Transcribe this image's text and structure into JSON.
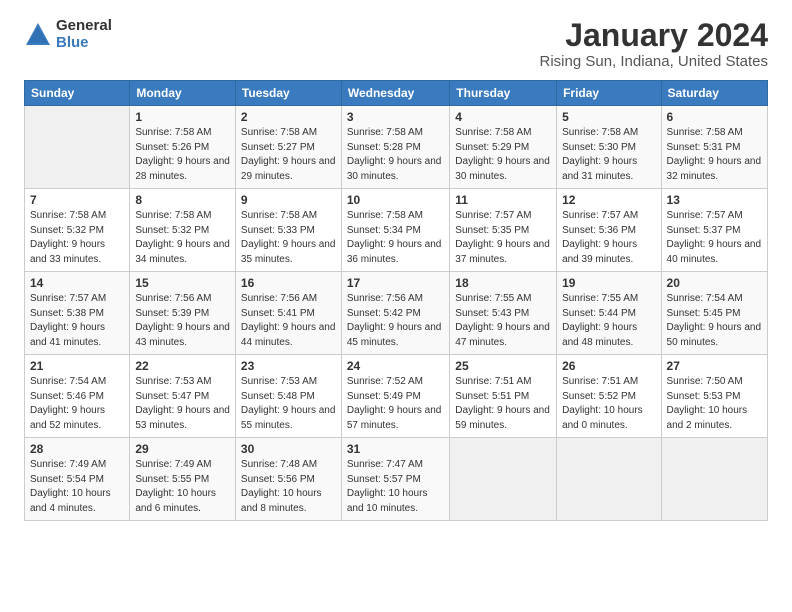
{
  "logo": {
    "general": "General",
    "blue": "Blue"
  },
  "title": "January 2024",
  "subtitle": "Rising Sun, Indiana, United States",
  "weekdays": [
    "Sunday",
    "Monday",
    "Tuesday",
    "Wednesday",
    "Thursday",
    "Friday",
    "Saturday"
  ],
  "weeks": [
    [
      {
        "day": "",
        "sunrise": "",
        "sunset": "",
        "daylight": ""
      },
      {
        "day": "1",
        "sunrise": "Sunrise: 7:58 AM",
        "sunset": "Sunset: 5:26 PM",
        "daylight": "Daylight: 9 hours and 28 minutes."
      },
      {
        "day": "2",
        "sunrise": "Sunrise: 7:58 AM",
        "sunset": "Sunset: 5:27 PM",
        "daylight": "Daylight: 9 hours and 29 minutes."
      },
      {
        "day": "3",
        "sunrise": "Sunrise: 7:58 AM",
        "sunset": "Sunset: 5:28 PM",
        "daylight": "Daylight: 9 hours and 30 minutes."
      },
      {
        "day": "4",
        "sunrise": "Sunrise: 7:58 AM",
        "sunset": "Sunset: 5:29 PM",
        "daylight": "Daylight: 9 hours and 30 minutes."
      },
      {
        "day": "5",
        "sunrise": "Sunrise: 7:58 AM",
        "sunset": "Sunset: 5:30 PM",
        "daylight": "Daylight: 9 hours and 31 minutes."
      },
      {
        "day": "6",
        "sunrise": "Sunrise: 7:58 AM",
        "sunset": "Sunset: 5:31 PM",
        "daylight": "Daylight: 9 hours and 32 minutes."
      }
    ],
    [
      {
        "day": "7",
        "sunrise": "Sunrise: 7:58 AM",
        "sunset": "Sunset: 5:32 PM",
        "daylight": "Daylight: 9 hours and 33 minutes."
      },
      {
        "day": "8",
        "sunrise": "Sunrise: 7:58 AM",
        "sunset": "Sunset: 5:32 PM",
        "daylight": "Daylight: 9 hours and 34 minutes."
      },
      {
        "day": "9",
        "sunrise": "Sunrise: 7:58 AM",
        "sunset": "Sunset: 5:33 PM",
        "daylight": "Daylight: 9 hours and 35 minutes."
      },
      {
        "day": "10",
        "sunrise": "Sunrise: 7:58 AM",
        "sunset": "Sunset: 5:34 PM",
        "daylight": "Daylight: 9 hours and 36 minutes."
      },
      {
        "day": "11",
        "sunrise": "Sunrise: 7:57 AM",
        "sunset": "Sunset: 5:35 PM",
        "daylight": "Daylight: 9 hours and 37 minutes."
      },
      {
        "day": "12",
        "sunrise": "Sunrise: 7:57 AM",
        "sunset": "Sunset: 5:36 PM",
        "daylight": "Daylight: 9 hours and 39 minutes."
      },
      {
        "day": "13",
        "sunrise": "Sunrise: 7:57 AM",
        "sunset": "Sunset: 5:37 PM",
        "daylight": "Daylight: 9 hours and 40 minutes."
      }
    ],
    [
      {
        "day": "14",
        "sunrise": "Sunrise: 7:57 AM",
        "sunset": "Sunset: 5:38 PM",
        "daylight": "Daylight: 9 hours and 41 minutes."
      },
      {
        "day": "15",
        "sunrise": "Sunrise: 7:56 AM",
        "sunset": "Sunset: 5:39 PM",
        "daylight": "Daylight: 9 hours and 43 minutes."
      },
      {
        "day": "16",
        "sunrise": "Sunrise: 7:56 AM",
        "sunset": "Sunset: 5:41 PM",
        "daylight": "Daylight: 9 hours and 44 minutes."
      },
      {
        "day": "17",
        "sunrise": "Sunrise: 7:56 AM",
        "sunset": "Sunset: 5:42 PM",
        "daylight": "Daylight: 9 hours and 45 minutes."
      },
      {
        "day": "18",
        "sunrise": "Sunrise: 7:55 AM",
        "sunset": "Sunset: 5:43 PM",
        "daylight": "Daylight: 9 hours and 47 minutes."
      },
      {
        "day": "19",
        "sunrise": "Sunrise: 7:55 AM",
        "sunset": "Sunset: 5:44 PM",
        "daylight": "Daylight: 9 hours and 48 minutes."
      },
      {
        "day": "20",
        "sunrise": "Sunrise: 7:54 AM",
        "sunset": "Sunset: 5:45 PM",
        "daylight": "Daylight: 9 hours and 50 minutes."
      }
    ],
    [
      {
        "day": "21",
        "sunrise": "Sunrise: 7:54 AM",
        "sunset": "Sunset: 5:46 PM",
        "daylight": "Daylight: 9 hours and 52 minutes."
      },
      {
        "day": "22",
        "sunrise": "Sunrise: 7:53 AM",
        "sunset": "Sunset: 5:47 PM",
        "daylight": "Daylight: 9 hours and 53 minutes."
      },
      {
        "day": "23",
        "sunrise": "Sunrise: 7:53 AM",
        "sunset": "Sunset: 5:48 PM",
        "daylight": "Daylight: 9 hours and 55 minutes."
      },
      {
        "day": "24",
        "sunrise": "Sunrise: 7:52 AM",
        "sunset": "Sunset: 5:49 PM",
        "daylight": "Daylight: 9 hours and 57 minutes."
      },
      {
        "day": "25",
        "sunrise": "Sunrise: 7:51 AM",
        "sunset": "Sunset: 5:51 PM",
        "daylight": "Daylight: 9 hours and 59 minutes."
      },
      {
        "day": "26",
        "sunrise": "Sunrise: 7:51 AM",
        "sunset": "Sunset: 5:52 PM",
        "daylight": "Daylight: 10 hours and 0 minutes."
      },
      {
        "day": "27",
        "sunrise": "Sunrise: 7:50 AM",
        "sunset": "Sunset: 5:53 PM",
        "daylight": "Daylight: 10 hours and 2 minutes."
      }
    ],
    [
      {
        "day": "28",
        "sunrise": "Sunrise: 7:49 AM",
        "sunset": "Sunset: 5:54 PM",
        "daylight": "Daylight: 10 hours and 4 minutes."
      },
      {
        "day": "29",
        "sunrise": "Sunrise: 7:49 AM",
        "sunset": "Sunset: 5:55 PM",
        "daylight": "Daylight: 10 hours and 6 minutes."
      },
      {
        "day": "30",
        "sunrise": "Sunrise: 7:48 AM",
        "sunset": "Sunset: 5:56 PM",
        "daylight": "Daylight: 10 hours and 8 minutes."
      },
      {
        "day": "31",
        "sunrise": "Sunrise: 7:47 AM",
        "sunset": "Sunset: 5:57 PM",
        "daylight": "Daylight: 10 hours and 10 minutes."
      },
      {
        "day": "",
        "sunrise": "",
        "sunset": "",
        "daylight": ""
      },
      {
        "day": "",
        "sunrise": "",
        "sunset": "",
        "daylight": ""
      },
      {
        "day": "",
        "sunrise": "",
        "sunset": "",
        "daylight": ""
      }
    ]
  ]
}
